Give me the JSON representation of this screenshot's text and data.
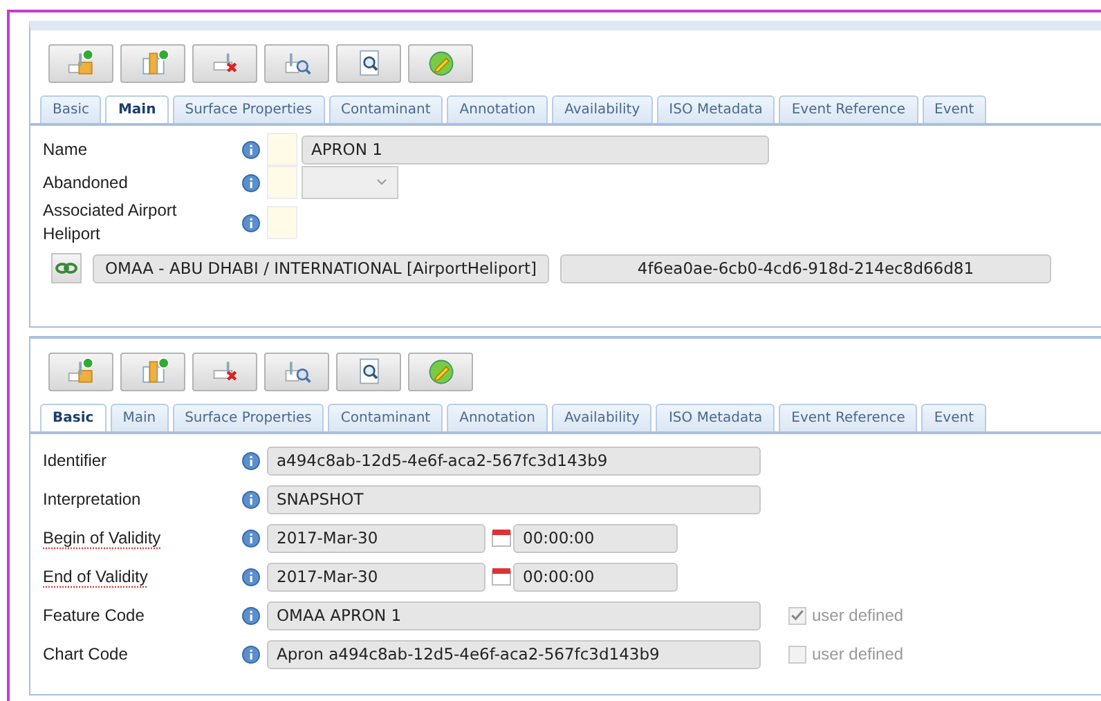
{
  "panels": [
    {
      "toolbar": [
        {
          "kind": "add"
        },
        {
          "kind": "add-child"
        },
        {
          "kind": "delete"
        },
        {
          "kind": "view"
        },
        {
          "kind": "search"
        },
        {
          "kind": "edit"
        }
      ],
      "tabs": [
        {
          "label": "Basic",
          "selected": false
        },
        {
          "label": "Main",
          "selected": true
        },
        {
          "label": "Surface Properties",
          "selected": false
        },
        {
          "label": "Contaminant",
          "selected": false
        },
        {
          "label": "Annotation",
          "selected": false
        },
        {
          "label": "Availability",
          "selected": false
        },
        {
          "label": "ISO Metadata",
          "selected": false
        },
        {
          "label": "Event Reference",
          "selected": false
        },
        {
          "label": "Event",
          "selected": false
        }
      ],
      "fields": [
        {
          "kind": "text",
          "label": "Name",
          "value": "APRON 1",
          "marker_box": true,
          "flagged": false
        },
        {
          "kind": "select",
          "label": "Abandoned",
          "marker_box": true,
          "flagged": false
        },
        {
          "kind": "none",
          "label": "Associated Airport Heliport",
          "marker_box": true,
          "flagged": false
        }
      ],
      "reference": {
        "value": "OMAA - ABU DHABI / INTERNATIONAL [AirportHeliport]",
        "id": "4f6ea0ae-6cb0-4cd6-918d-214ec8d66d81"
      }
    },
    {
      "toolbar": [
        {
          "kind": "add"
        },
        {
          "kind": "add-child"
        },
        {
          "kind": "delete"
        },
        {
          "kind": "view"
        },
        {
          "kind": "search"
        },
        {
          "kind": "edit"
        }
      ],
      "tabs": [
        {
          "label": "Basic",
          "selected": true
        },
        {
          "label": "Main",
          "selected": false
        },
        {
          "label": "Surface Properties",
          "selected": false
        },
        {
          "label": "Contaminant",
          "selected": false
        },
        {
          "label": "Annotation",
          "selected": false
        },
        {
          "label": "Availability",
          "selected": false
        },
        {
          "label": "ISO Metadata",
          "selected": false
        },
        {
          "label": "Event Reference",
          "selected": false
        },
        {
          "label": "Event",
          "selected": false
        }
      ],
      "fields": [
        {
          "kind": "text",
          "label": "Identifier",
          "value": "a494c8ab-12d5-4e6f-aca2-567fc3d143b9",
          "marker_box": false,
          "flagged": false
        },
        {
          "kind": "text",
          "label": "Interpretation",
          "value": "SNAPSHOT",
          "marker_box": false,
          "flagged": false
        },
        {
          "kind": "datetime",
          "label": "Begin of Validity",
          "date": "2017-Mar-30",
          "time": "00:00:00",
          "marker_box": false,
          "flagged": true
        },
        {
          "kind": "datetime",
          "label": "End of Validity",
          "date": "2017-Mar-30",
          "time": "00:00:00",
          "marker_box": false,
          "flagged": true
        },
        {
          "kind": "text",
          "label": "Feature Code",
          "value": "OMAA APRON 1",
          "marker_box": false,
          "flagged": false,
          "option": {
            "label": "user defined",
            "checked": true
          }
        },
        {
          "kind": "text",
          "label": "Chart Code",
          "value": "Apron a494c8ab-12d5-4e6f-aca2-567fc3d143b9",
          "marker_box": false,
          "flagged": false,
          "option": {
            "label": "user defined",
            "checked": false
          }
        }
      ]
    }
  ]
}
